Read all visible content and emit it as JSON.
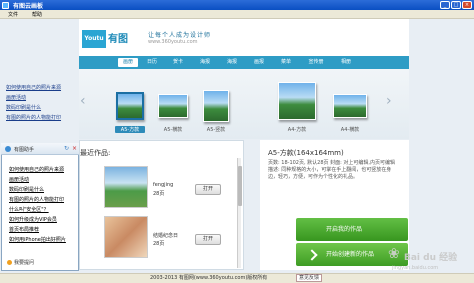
{
  "window": {
    "title": "有图云画板"
  },
  "menu": {
    "file": "文件",
    "help": "帮助"
  },
  "header": {
    "logo_text": "Youtu",
    "logo_cn": "有图",
    "slogan": "让每个人成为设计师",
    "url": "www.360youtu.com"
  },
  "tabs": [
    "画册",
    "日历",
    "贺卡",
    "海报",
    "海报",
    "画报",
    "菜单",
    "宣传册",
    "相册"
  ],
  "products": [
    {
      "label": "A5-方款",
      "selected": true
    },
    {
      "label": "A5-横款",
      "selected": false
    },
    {
      "label": "A5-竖款",
      "selected": false
    },
    {
      "label": "A4-方款",
      "selected": false
    },
    {
      "label": "A4-横款",
      "selected": false
    }
  ],
  "works": {
    "title": "最近作品:",
    "items": [
      {
        "name": "fengjing",
        "pages": "28页",
        "open": "打开"
      },
      {
        "name": "结婚纪念日",
        "pages": "28页",
        "open": "打开"
      }
    ]
  },
  "detail": {
    "title": "A5-方款(164x164mm)",
    "desc": "页数: 18-102页, 默认28页 封面: 对上可编辑,内页可编辑 描述: 同种规格的大小，可掌在手上翻阅，也可竖放在身边，轻巧，方便，可作为个性化的礼品。",
    "create_btn": "开始创建新的作品",
    "create2_btn": "开启我的作品"
  },
  "helper": {
    "title": "有图助手",
    "faqs": [
      "如何使用自己的照片来源",
      "画册活动",
      "数码印刷是什么",
      "有图的照片的人物能打印",
      "什么叫\"安全区\"？",
      "如何升级成为VIP会员",
      "首页布局推荐",
      "如何用iPhone拍出好照片"
    ],
    "footer": "我要提问"
  },
  "leftlist": [
    "如何使用自己的照片来源",
    "画册活动",
    "数码印刷是什么",
    "有图的照片的人物能打印",
    "什么叫\"安全区\"？",
    "如何升级成为VIP会员",
    "首页布局推荐",
    "如何用iPhone拍出好照片"
  ],
  "status": {
    "copyright": "2003-2013 有图网(www.360youtu.com)版权所有",
    "feedback": "意见反馈"
  },
  "watermark": {
    "brand": "Bai du 经验",
    "url": "jingyan.baidu.com"
  },
  "colors": {
    "accent": "#2e9cc5",
    "create_green": "#4aa82e"
  }
}
